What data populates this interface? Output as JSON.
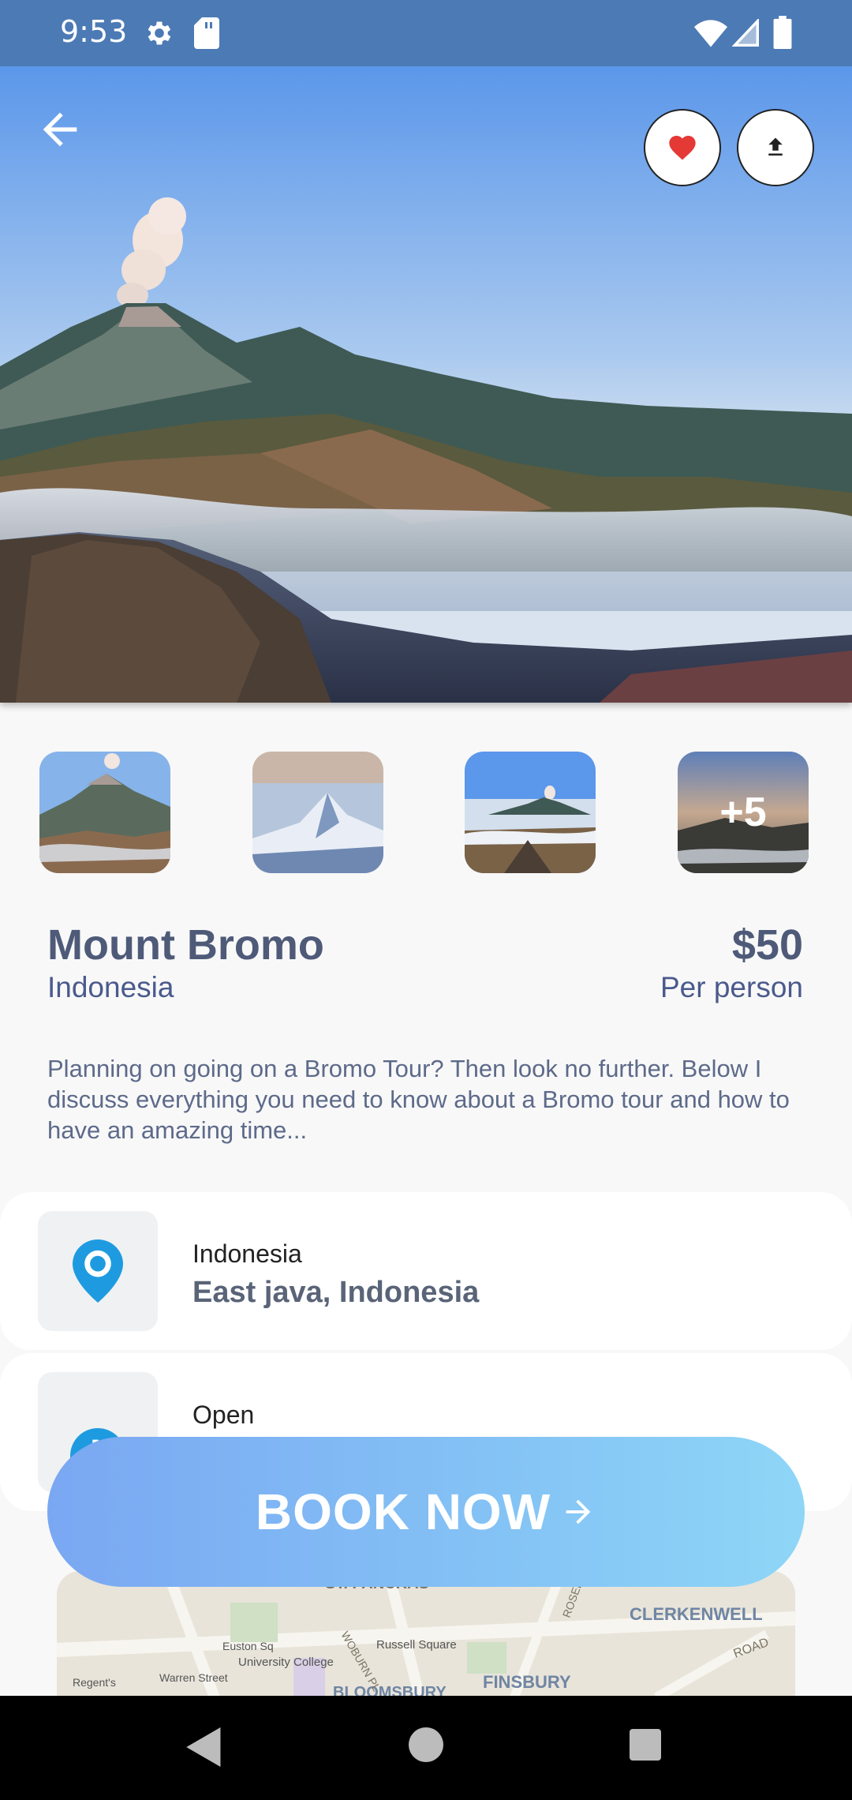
{
  "status_bar": {
    "time": "9:53",
    "icons": [
      "gear-icon",
      "sd-card-icon",
      "wifi-icon",
      "signal-icon",
      "battery-icon"
    ]
  },
  "header": {
    "back_icon": "arrow-left-icon",
    "favorite_icon": "heart-icon",
    "share_icon": "upload-icon",
    "favorite_color": "#e53935"
  },
  "gallery": {
    "more_label": "+5"
  },
  "destination": {
    "name": "Mount Bromo",
    "country": "Indonesia",
    "price": "$50",
    "price_unit": "Per person",
    "description": "Planning on going on a Bromo Tour? Then look no further. Below I discuss everything you need to know about a Bromo tour and how to have an amazing time..."
  },
  "info": {
    "location": {
      "icon": "map-pin-icon",
      "label": "Indonesia",
      "value": "East java, Indonesia"
    },
    "hours": {
      "icon": "clock-icon",
      "label": "Open"
    },
    "icon_color": "#1e9be0"
  },
  "map": {
    "labels": [
      "ST. PANCRAS",
      "CLERKENWELL",
      "FINSBURY",
      "BLOOMSBURY",
      "Russell Square",
      "University College",
      "Euston Sq",
      "Warren Street",
      "Regent's",
      "Euston",
      "WOBURN PL",
      "ROSEBERY",
      "ROAD"
    ]
  },
  "book_button": {
    "label": "BOOK NOW",
    "arrow_icon": "arrow-right-icon"
  },
  "nav_bar": {
    "icons": [
      "nav-back-icon",
      "nav-home-icon",
      "nav-recents-icon"
    ]
  }
}
